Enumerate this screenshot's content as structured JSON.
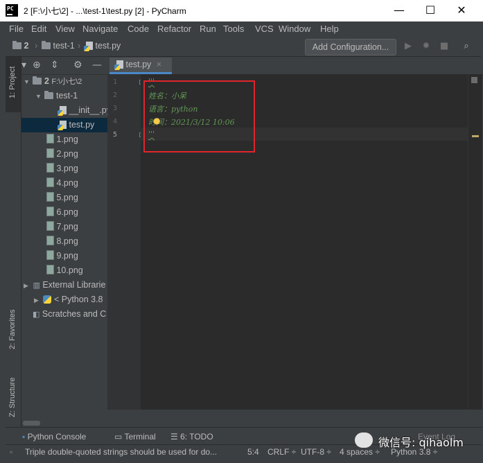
{
  "window": {
    "title": "2 [F:\\小七\\2] - ...\\test-1\\test.py [2] - PyCharm",
    "logo_text": "PC",
    "min": "—",
    "max": "☐",
    "close": "✕"
  },
  "menu": [
    "File",
    "Edit",
    "View",
    "Navigate",
    "Code",
    "Refactor",
    "Run",
    "Tools",
    "VCS",
    "Window",
    "Help"
  ],
  "breadcrumb": {
    "project": "2",
    "folder": "test-1",
    "file": "test.py"
  },
  "toolbar": {
    "add_configuration": "Add Configuration..."
  },
  "left_stripe": {
    "project_tab": "1: Project",
    "favorites_tab": "2: Favorites",
    "structure_tab": "Z: Structure"
  },
  "tree": {
    "root": "2",
    "root_path": "F:\\小七\\2",
    "folder": "test-1",
    "files": [
      "__init__.py",
      "test.py"
    ],
    "images": [
      "1.png",
      "2.png",
      "3.png",
      "4.png",
      "5.png",
      "6.png",
      "7.png",
      "8.png",
      "9.png",
      "10.png"
    ],
    "external_libraries": "External Librarie",
    "python_sdk": "< Python 3.8",
    "scratches": "Scratches and C"
  },
  "editor": {
    "tab_label": "test.py",
    "tab_close": "×",
    "line_numbers": [
      "1",
      "2",
      "3",
      "4",
      "5"
    ],
    "lines": [
      "'''",
      "姓名：小呆",
      "语言：python",
      "时间：2021/3/12  10:06",
      "'''"
    ]
  },
  "bottom_tabs": {
    "python_console": "Python Console",
    "terminal": "Terminal",
    "todo": "6: TODO",
    "event_log": "Event Log"
  },
  "status": {
    "message": "Triple double-quoted strings should be used for do...",
    "position": "5:4",
    "line_sep": "CRLF ÷",
    "encoding": "UTF-8 ÷",
    "indent": "4 spaces ÷",
    "interpreter": "Python 3.8 ÷"
  },
  "watermark": {
    "text": "微信号: qihaolm"
  }
}
